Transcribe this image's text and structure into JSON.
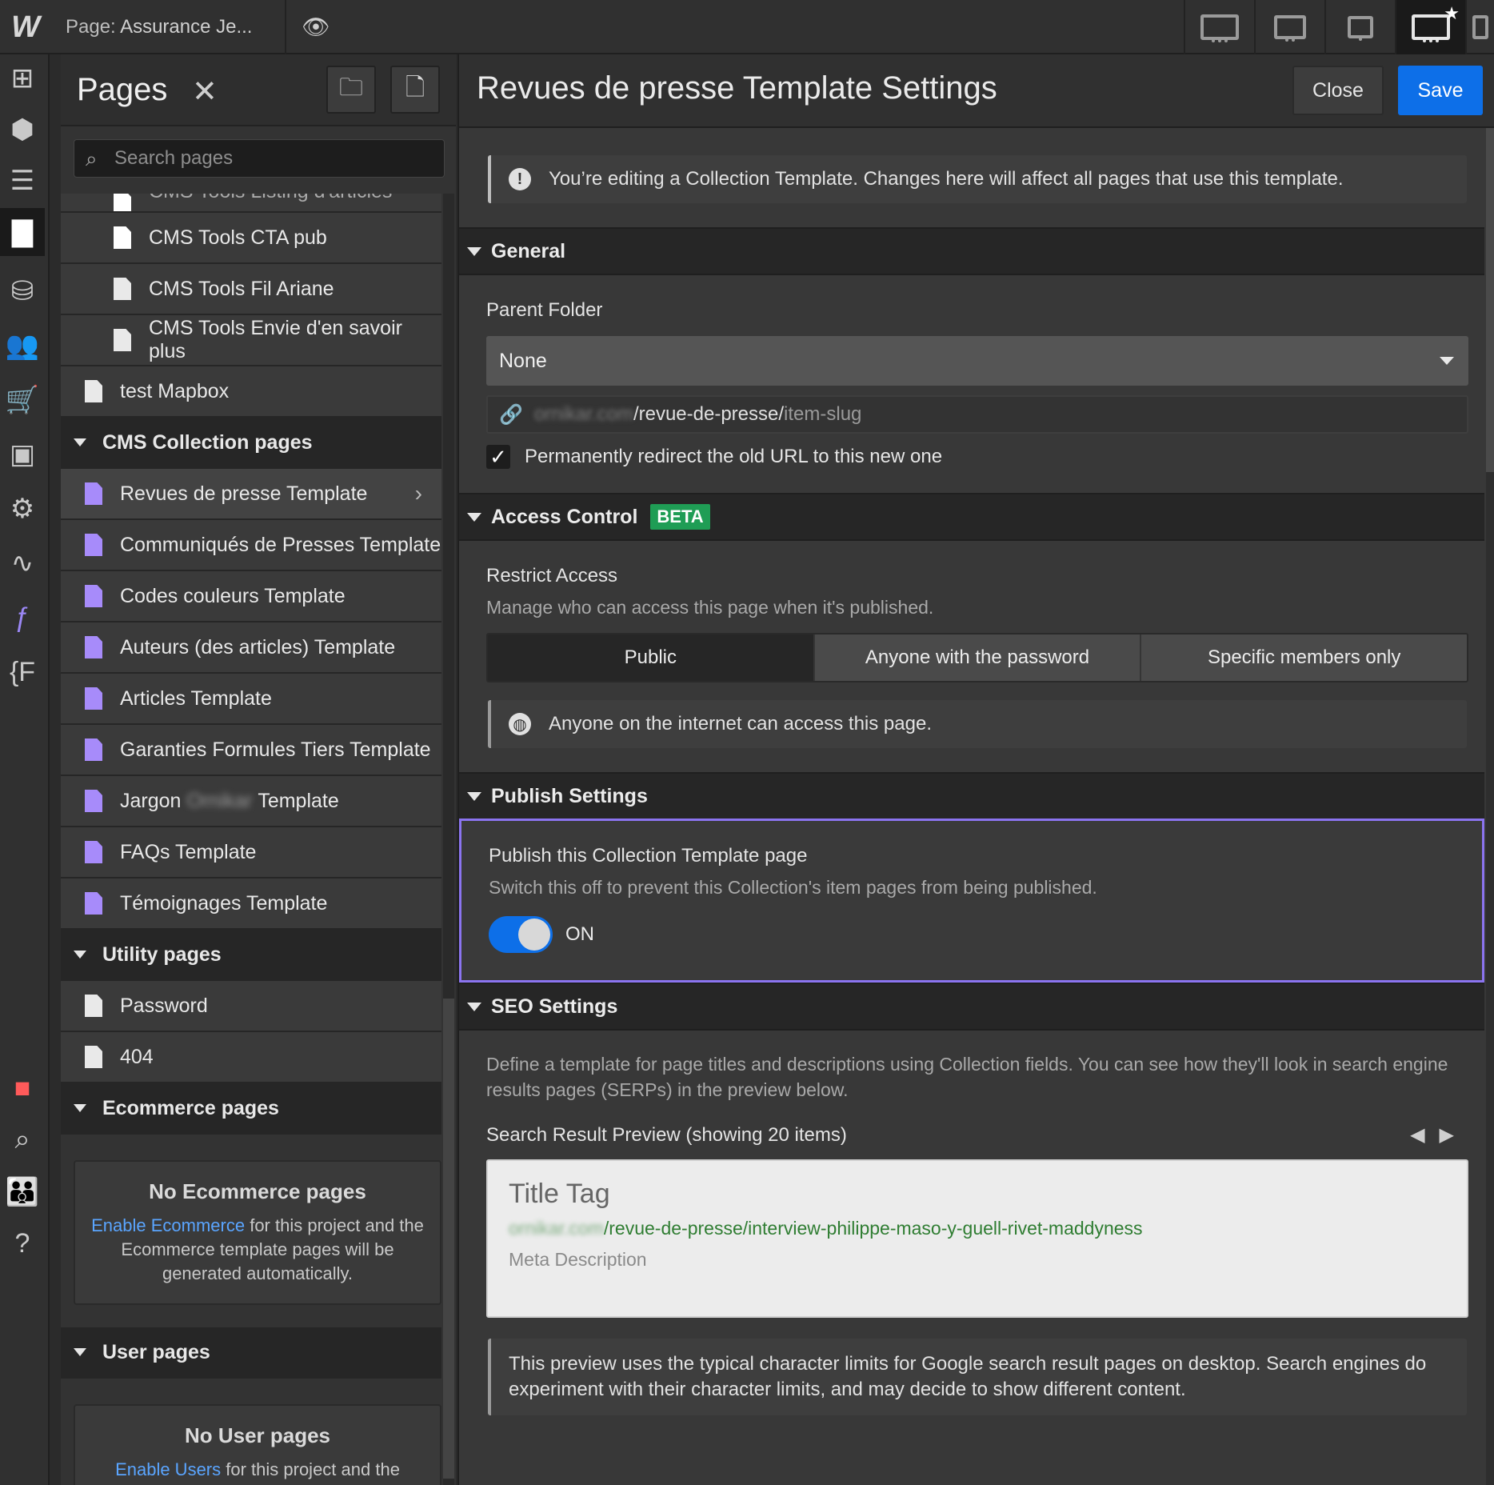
{
  "topbar": {
    "logo": "W",
    "page_prefix": "Page:",
    "page_name": "Assurance Je...",
    "preview_icon": "eye-icon",
    "devices": [
      "desktop-icon",
      "tablet-icon",
      "mobile-landscape-icon",
      "desktop-star-icon",
      "mobile-portrait-icon"
    ]
  },
  "rail": {
    "icons": [
      "add-icon",
      "box-icon",
      "navigator-icon",
      "pages-icon",
      "cms-icon",
      "users-icon",
      "ecommerce-icon",
      "assets-icon",
      "settings-icon",
      "activity-icon",
      "apps-icon",
      "font-icon",
      "record-icon",
      "search-icon",
      "team-icon",
      "help-icon"
    ]
  },
  "pages_panel": {
    "title": "Pages",
    "close": "✕",
    "search_placeholder": "Search pages",
    "partial_row": "CMS Tools Listing d'articles",
    "static_rows": [
      {
        "label": "CMS Tools CTA pub"
      },
      {
        "label": "CMS Tools Fil Ariane"
      },
      {
        "label": "CMS Tools Envie d'en savoir plus"
      },
      {
        "label": "test Mapbox"
      }
    ],
    "cms_group": "CMS Collection pages",
    "cms_rows": [
      {
        "label": "Revues de presse Template"
      },
      {
        "label": "Communiqués de Presses Template"
      },
      {
        "label": "Codes couleurs Template"
      },
      {
        "label": "Auteurs (des articles) Template"
      },
      {
        "label": "Articles Template"
      },
      {
        "label": "Garanties Formules Tiers Template"
      },
      {
        "label_a": "Jargon",
        "label_blur": "Ornikar",
        "label_b": "Template"
      },
      {
        "label": "FAQs Template"
      },
      {
        "label": "Témoignages Template"
      }
    ],
    "utility_group": "Utility pages",
    "utility_rows": [
      {
        "label": "Password"
      },
      {
        "label": "404"
      }
    ],
    "ecommerce_group": "Ecommerce pages",
    "ecommerce_empty": {
      "title": "No Ecommerce pages",
      "link": "Enable Ecommerce",
      "text": " for this project and the Ecommerce template pages will be generated automatically."
    },
    "user_group": "User pages",
    "user_empty": {
      "title": "No User pages",
      "link": "Enable Users",
      "text": " for this project and the Users template pages will be"
    }
  },
  "settings": {
    "title": "Revues de presse Template Settings",
    "close": "Close",
    "save": "Save",
    "notice": "You’re editing a Collection Template. Changes here will affect all pages that use this template.",
    "general": {
      "heading": "General",
      "parent_folder_label": "Parent Folder",
      "parent_folder_value": "None",
      "url_domain": "ornikar.com",
      "url_path": "/revue-de-presse/",
      "url_slug": "item-slug",
      "redirect_label": "Permanently redirect the old URL to this new one",
      "redirect_checked": true
    },
    "access": {
      "heading": "Access Control",
      "badge": "BETA",
      "label": "Restrict Access",
      "sub": "Manage who can access this page when it's published.",
      "options": [
        "Public",
        "Anyone with the password",
        "Specific members only"
      ],
      "selected": "Public",
      "info": "Anyone on the internet can access this page."
    },
    "publish": {
      "heading": "Publish Settings",
      "label": "Publish this Collection Template page",
      "sub": "Switch this off to prevent this Collection's item pages from being published.",
      "toggle_state": "ON"
    },
    "seo": {
      "heading": "SEO Settings",
      "desc": "Define a template for page titles and descriptions using Collection fields. You can see how they'll look in search engine results pages (SERPs) in the preview below.",
      "preview_label": "Search Result Preview (showing 20 items)",
      "prev": "◀",
      "next": "▶",
      "serp_title": "Title Tag",
      "serp_domain": "ornikar.com",
      "serp_path": "/revue-de-presse/interview-philippe-maso-y-guell-rivet-maddyness",
      "serp_meta": "Meta Description",
      "footnote": "This preview uses the typical character limits for Google search result pages on desktop. Search engines do experiment with their character limits, and may decide to show different content."
    }
  },
  "colors": {
    "accent_blue": "#0d6fe8",
    "beta_green": "#1f9d55",
    "template_purple": "#a78bfa",
    "focus_border": "#8b74f0",
    "link_blue": "#5aa5ff"
  }
}
